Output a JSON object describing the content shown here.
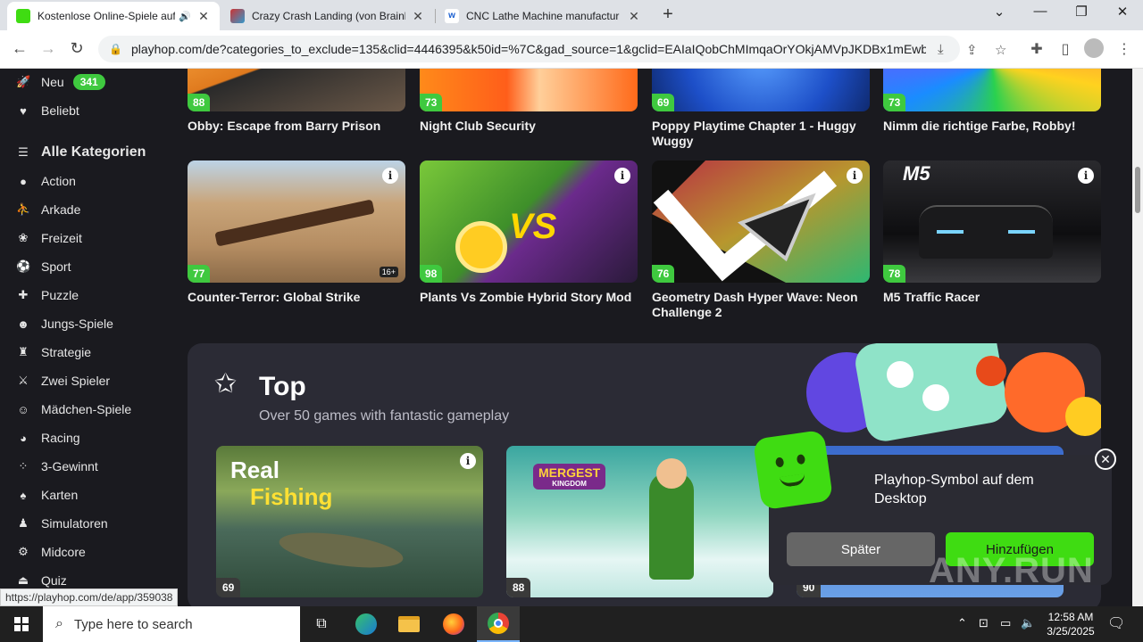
{
  "browser": {
    "tabs": [
      {
        "title": "Kostenlose Online-Spiele auf",
        "active": true
      },
      {
        "title": "Crazy Crash Landing (von Brainl",
        "active": false
      },
      {
        "title": "CNC Lathe Machine manufactur",
        "active": false
      }
    ],
    "url": "playhop.com/de?categories_to_exclude=135&clid=4446395&k50id=%7C&gad_source=1&gclid=EAIaIQobChMImqaOrYOkjAMVpJKDBx1mEwb..."
  },
  "sidebar": {
    "new_label": "Neu",
    "new_count": "341",
    "popular_label": "Beliebt",
    "all_categories": "Alle Kategorien",
    "categories": [
      "Action",
      "Arkade",
      "Freizeit",
      "Sport",
      "Puzzle",
      "Jungs-Spiele",
      "Strategie",
      "Zwei Spieler",
      "Mädchen-Spiele",
      "Racing",
      "3-Gewinnt",
      "Karten",
      "Simulatoren",
      "Midcore",
      "Quiz"
    ]
  },
  "games_row1": [
    {
      "title": "Obby: Escape from Barry Prison",
      "score": "88"
    },
    {
      "title": "Night Club Security",
      "score": "73"
    },
    {
      "title": "Poppy Playtime Chapter 1 - Huggy Wuggy",
      "score": "69"
    },
    {
      "title": "Nimm die richtige Farbe, Robby!",
      "score": "73"
    }
  ],
  "games_row2": [
    {
      "title": "Counter-Terror: Global Strike",
      "score": "77",
      "age": "16+"
    },
    {
      "title": "Plants Vs Zombie Hybrid Story Mod",
      "score": "98",
      "vs": "VS"
    },
    {
      "title": "Geometry Dash Hyper Wave: Neon Challenge 2",
      "score": "76"
    },
    {
      "title": "M5 Traffic Racer",
      "score": "78",
      "logo": "M5"
    }
  ],
  "top": {
    "title": "Top",
    "subtitle": "Over 50 games with fantastic gameplay",
    "cards": [
      {
        "score": "69",
        "line1": "Real",
        "line2": "Fishing"
      },
      {
        "score": "88",
        "logo1": "MERGEST",
        "logo2": "KINGDOM"
      },
      {
        "score": "90"
      }
    ]
  },
  "popup": {
    "text": "Playhop-Symbol auf dem Desktop",
    "later": "Später",
    "add": "Hinzufügen"
  },
  "status_url": "https://playhop.com/de/app/359038",
  "watermark": "ANY.RUN",
  "taskbar": {
    "search_placeholder": "Type here to search",
    "time": "12:58 AM",
    "date": "3/25/2025"
  },
  "colors": {
    "accent": "#3fc93f",
    "add_button": "#3fdc12"
  }
}
